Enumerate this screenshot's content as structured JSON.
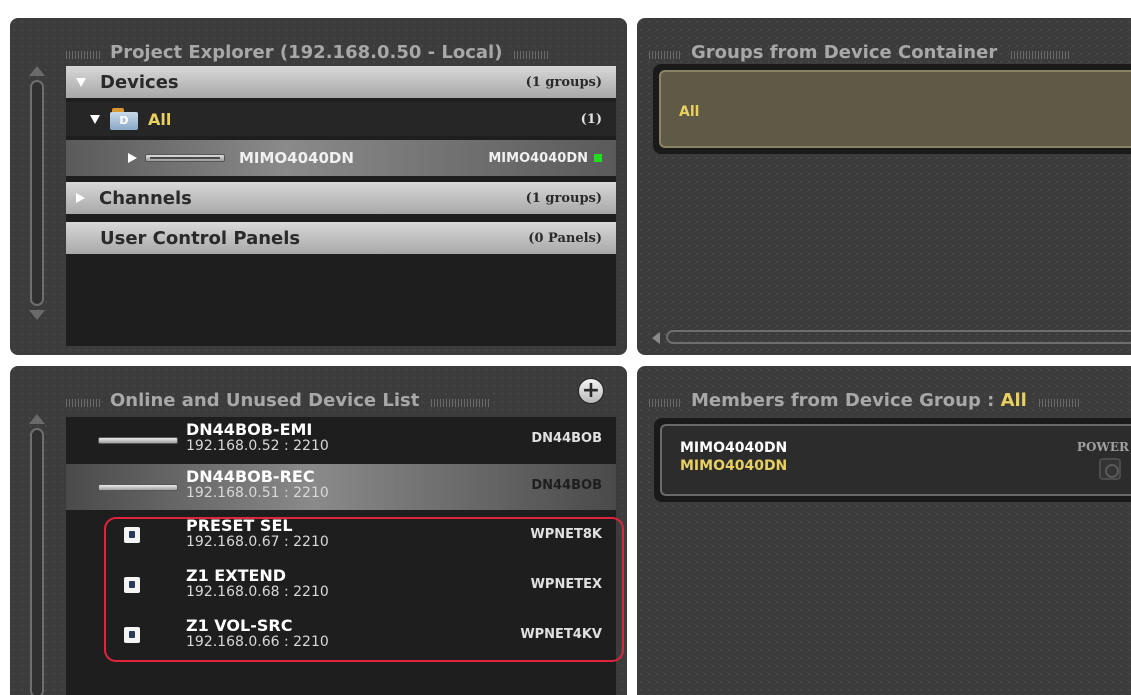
{
  "project_explorer": {
    "title": "Project Explorer (192.168.0.50 - Local)",
    "rows": {
      "devices": {
        "label": "Devices",
        "count": "(1 groups)"
      },
      "all": {
        "folder_letter": "D",
        "label": "All",
        "count": "(1)"
      },
      "device": {
        "label": "MIMO4040DN",
        "model": "MIMO4040DN",
        "status_color": "#22dd22"
      },
      "channels": {
        "label": "Channels",
        "count": "(1 groups)"
      },
      "ucp": {
        "label": "User Control Panels",
        "count": "(0 Panels)"
      }
    }
  },
  "groups_panel": {
    "title": "Groups from Device Container",
    "group_label": "All"
  },
  "device_list": {
    "title": "Online and Unused Device List",
    "add_label": "+",
    "devices": [
      {
        "name": "DN44BOB-EMI",
        "ip": "192.168.0.52 : 2210",
        "type": "DN44BOB",
        "icon": "rack-device-icon"
      },
      {
        "name": "DN44BOB-REC",
        "ip": "192.168.0.51 : 2210",
        "type": "DN44BOB",
        "icon": "rack-device-icon"
      },
      {
        "name": "PRESET SEL",
        "ip": "192.168.0.67 : 2210",
        "type": "WPNET8K",
        "icon": "wall-panel-icon"
      },
      {
        "name": "Z1 EXTEND",
        "ip": "192.168.0.68 : 2210",
        "type": "WPNETEX",
        "icon": "wall-panel-icon"
      },
      {
        "name": "Z1 VOL-SRC",
        "ip": "192.168.0.66 : 2210",
        "type": "WPNET4KV",
        "icon": "wall-panel-icon"
      }
    ]
  },
  "members_panel": {
    "title_prefix": "Members from Device Group : ",
    "title_group": "All",
    "member": {
      "name": "MIMO4040DN",
      "type": "MIMO4040DN",
      "power_label": "POWER"
    }
  },
  "colors": {
    "accent": "#e8d060",
    "highlight": "#e0243c",
    "online": "#22dd22"
  }
}
